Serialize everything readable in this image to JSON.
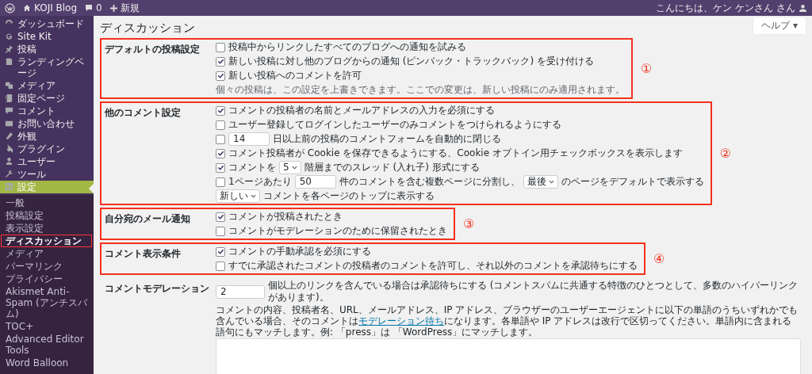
{
  "admin_bar": {
    "site": "KOJI Blog",
    "comments": "0",
    "new": "新規",
    "greeting": "こんにちは、ケン ケンさん さん"
  },
  "help_button": "ヘルプ ▾",
  "sidebar": {
    "items": [
      {
        "label": "ダッシュボード",
        "selected": false
      },
      {
        "label": "Site Kit",
        "selected": false
      },
      {
        "label": "投稿",
        "selected": false
      },
      {
        "label": "ランディングページ",
        "selected": false
      },
      {
        "label": "メディア",
        "selected": false
      },
      {
        "label": "固定ページ",
        "selected": false
      },
      {
        "label": "コメント",
        "selected": false
      },
      {
        "label": "お問い合わせ",
        "selected": false
      },
      {
        "label": "外観",
        "selected": false
      },
      {
        "label": "プラグイン",
        "selected": false
      },
      {
        "label": "ユーザー",
        "selected": false
      },
      {
        "label": "ツール",
        "selected": false
      },
      {
        "label": "設定",
        "selected": true
      }
    ],
    "submenu": [
      {
        "label": "一般",
        "selected": false,
        "annotated": false
      },
      {
        "label": "投稿設定",
        "selected": false,
        "annotated": false
      },
      {
        "label": "表示設定",
        "selected": false,
        "annotated": false
      },
      {
        "label": "ディスカッション",
        "selected": true,
        "annotated": true
      },
      {
        "label": "メディア",
        "selected": false,
        "annotated": false
      },
      {
        "label": "パーマリンク",
        "selected": false,
        "annotated": false
      },
      {
        "label": "プライバシー",
        "selected": false,
        "annotated": false
      },
      {
        "label": "Akismet Anti-Spam (アンチスパム)",
        "selected": false,
        "annotated": false
      },
      {
        "label": "TOC+",
        "selected": false,
        "annotated": false
      },
      {
        "label": "Advanced Editor Tools",
        "selected": false,
        "annotated": false
      },
      {
        "label": "Word Balloon",
        "selected": false,
        "annotated": false
      }
    ]
  },
  "page_title": "ディスカッション",
  "sections": [
    {
      "label": "デフォルトの投稿設定",
      "annotation": "①",
      "rows": [
        {
          "parts": [
            {
              "kind": "checkbox",
              "checked": false
            },
            {
              "kind": "text",
              "text": "投稿中からリンクしたすべてのブログへの通知を試みる"
            }
          ]
        },
        {
          "parts": [
            {
              "kind": "checkbox",
              "checked": true
            },
            {
              "kind": "text",
              "text": "新しい投稿に対し他のブログからの通知 (ピンバック・トラックバック) を受け付ける"
            }
          ]
        },
        {
          "parts": [
            {
              "kind": "checkbox",
              "checked": true
            },
            {
              "kind": "text",
              "text": "新しい投稿へのコメントを許可"
            }
          ]
        },
        {
          "parts": [
            {
              "kind": "note",
              "text": "個々の投稿は、この設定を上書きできます。ここでの変更は、新しい投稿にのみ適用されます。"
            }
          ]
        }
      ]
    },
    {
      "label": "他のコメント設定",
      "annotation": "②",
      "rows": [
        {
          "parts": [
            {
              "kind": "checkbox",
              "checked": true
            },
            {
              "kind": "text",
              "text": "コメントの投稿者の名前とメールアドレスの入力を必須にする"
            }
          ]
        },
        {
          "parts": [
            {
              "kind": "checkbox",
              "checked": false
            },
            {
              "kind": "text",
              "text": "ユーザー登録してログインしたユーザーのみコメントをつけられるようにする"
            }
          ]
        },
        {
          "parts": [
            {
              "kind": "checkbox",
              "checked": false
            },
            {
              "kind": "input",
              "value": "14"
            },
            {
              "kind": "text",
              "text": "日以上前の投稿のコメントフォームを自動的に閉じる"
            }
          ]
        },
        {
          "parts": [
            {
              "kind": "checkbox",
              "checked": true
            },
            {
              "kind": "text",
              "text": "コメント投稿者が Cookie を保存できるようにする、Cookie オプトイン用チェックボックスを表示します"
            }
          ]
        },
        {
          "parts": [
            {
              "kind": "checkbox",
              "checked": true
            },
            {
              "kind": "text",
              "text": "コメントを"
            },
            {
              "kind": "select",
              "value": "5"
            },
            {
              "kind": "text",
              "text": "階層までのスレッド (入れ子) 形式にする"
            }
          ]
        },
        {
          "parts": [
            {
              "kind": "checkbox",
              "checked": false
            },
            {
              "kind": "text",
              "text": "1ページあたり"
            },
            {
              "kind": "input",
              "value": "50"
            },
            {
              "kind": "text",
              "text": "件のコメントを含む複数ページに分割し、"
            },
            {
              "kind": "select",
              "value": "最後"
            },
            {
              "kind": "text",
              "text": "のページをデフォルトで表示する"
            }
          ]
        },
        {
          "parts": [
            {
              "kind": "select",
              "value": "新しい"
            },
            {
              "kind": "text",
              "text": "コメントを各ページのトップに表示する"
            }
          ]
        }
      ]
    },
    {
      "label": "自分宛のメール通知",
      "annotation": "③",
      "rows": [
        {
          "parts": [
            {
              "kind": "checkbox",
              "checked": true
            },
            {
              "kind": "text",
              "text": "コメントが投稿されたとき"
            }
          ]
        },
        {
          "parts": [
            {
              "kind": "checkbox",
              "checked": false
            },
            {
              "kind": "text",
              "text": "コメントがモデレーションのために保留されたとき"
            }
          ]
        }
      ]
    },
    {
      "label": "コメント表示条件",
      "annotation": "④",
      "rows": [
        {
          "parts": [
            {
              "kind": "checkbox",
              "checked": true
            },
            {
              "kind": "text",
              "text": "コメントの手動承認を必須にする"
            }
          ]
        },
        {
          "parts": [
            {
              "kind": "checkbox",
              "checked": false
            },
            {
              "kind": "text",
              "text": "すでに承認されたコメントの投稿者のコメントを許可し、それ以外のコメントを承認待ちにする"
            }
          ]
        }
      ]
    },
    {
      "label": "コメントモデレーション",
      "rows": [
        {
          "parts": [
            {
              "kind": "input",
              "value": "2"
            },
            {
              "kind": "text",
              "text": "個以上のリンクを含んでいる場合は承認待ちにする (コメントスパムに共通する特徴のひとつとして、多数のハイパーリンクがあります)。"
            }
          ]
        },
        {
          "parts": [
            {
              "kind": "paragraph",
              "before": "コメントの内容、投稿者名、URL、メールアドレス、IP アドレス、ブラウザーのユーザーエージェントに以下の単語のうちいずれかでも含んでいる場合、そのコメントは",
              "link": "モデレーション待ち",
              "after": "になります。各単語や IP アドレスは改行で区切ってください。単語内に含まれる語句にもマッチします。例: 「press」は 「WordPress」にマッチします。"
            }
          ]
        },
        {
          "parts": [
            {
              "kind": "textarea"
            }
          ]
        }
      ]
    }
  ]
}
